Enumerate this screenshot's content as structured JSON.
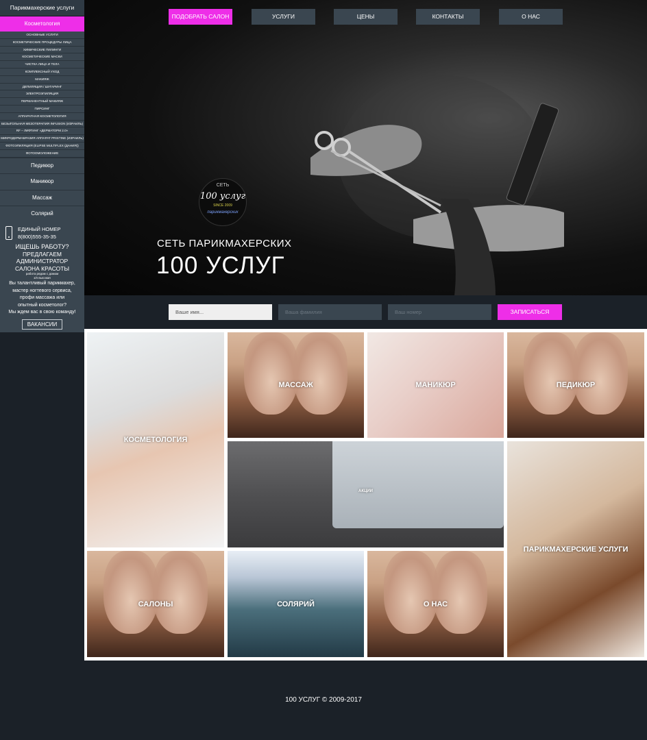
{
  "sidebar": {
    "header": "Парикмахерские услуги",
    "active": "Косметология",
    "sub_items": [
      "Основные услуги",
      "Косметические процедуры лица",
      "Химические пилинги",
      "Косметические маски",
      "Чистка лица и тела",
      "Комплексный уход",
      "Макияж",
      "Депиляция / Шугаринг",
      "Электроэпиляция",
      "Перманентный макияж",
      "Пирсинг",
      "Аппаратная косметология",
      "Безыгольная мезотерапия INFUSION (Израиль)",
      "RF – лифтинг «Дерматорм 2.0»",
      "Микродермабразия аппарат PRISTINE (Израиль)",
      "Фотоэпиляция (ELIPSE MULTIFLEX (Дания))",
      "Фотоомоложение"
    ],
    "main_items": [
      "Педикюр",
      "Маникюр",
      "Массаж",
      "Солярий"
    ],
    "promo": {
      "phone_label": "ЕДИНЫЙ НОМЕР",
      "phone": "8(800)555-35-35",
      "job_q": "ИЩЕШЬ РАБОТУ?",
      "offer": "ПРЕДЛАГАЕМ",
      "role1": "АДМИНИСТРАТОР",
      "role2": "САЛОНА КРАСОТЫ",
      "tiny1": "работа рядом с домом",
      "tiny2": "з/п высокая",
      "text1": "Вы талантливый парикмахер,",
      "text2": "мастер ногтевого сервиса,",
      "text3": "профи массажа или",
      "text4": "опытный косметолог?",
      "text5": "Мы ждем вас в свою команду!",
      "button": "ВАКАНСИИ"
    }
  },
  "nav": [
    "ПОДОБРАТЬ САЛОН",
    "УСЛУГИ",
    "ЦЕНЫ",
    "КОНТАКТЫ",
    "О НАС"
  ],
  "hero": {
    "logo_top": "СЕТЬ",
    "logo_mid": "100 услуг",
    "logo_since": "SINCE 2009",
    "logo_bottom": "парикмахерских",
    "subtitle": "СЕТЬ ПАРИКМАХЕРСКИХ",
    "title": "100 УСЛУГ"
  },
  "form": {
    "name_ph": "Ваше имя...",
    "surname_ph": "Ваша фамилия",
    "phone_ph": "Ваш номер",
    "submit": "ЗАПИСАТЬСЯ"
  },
  "tiles": {
    "cosmetology": "КОСМЕТОЛОГИЯ",
    "massage": "МАССАЖ",
    "manicure": "МАНИКЮР",
    "pedicure": "ПЕДИКЮР",
    "promos": "АКЦИИ",
    "hairdressing": "ПАРИКМАХЕРСКИЕ УСЛУГИ",
    "salons": "САЛОНЫ",
    "solarium": "СОЛЯРИЙ",
    "about": "О НАС"
  },
  "footer": "100 УСЛУГ © 2009-2017",
  "colors": {
    "accent": "#ee2ee8",
    "panel": "#3a4650",
    "background": "#1b2128"
  }
}
